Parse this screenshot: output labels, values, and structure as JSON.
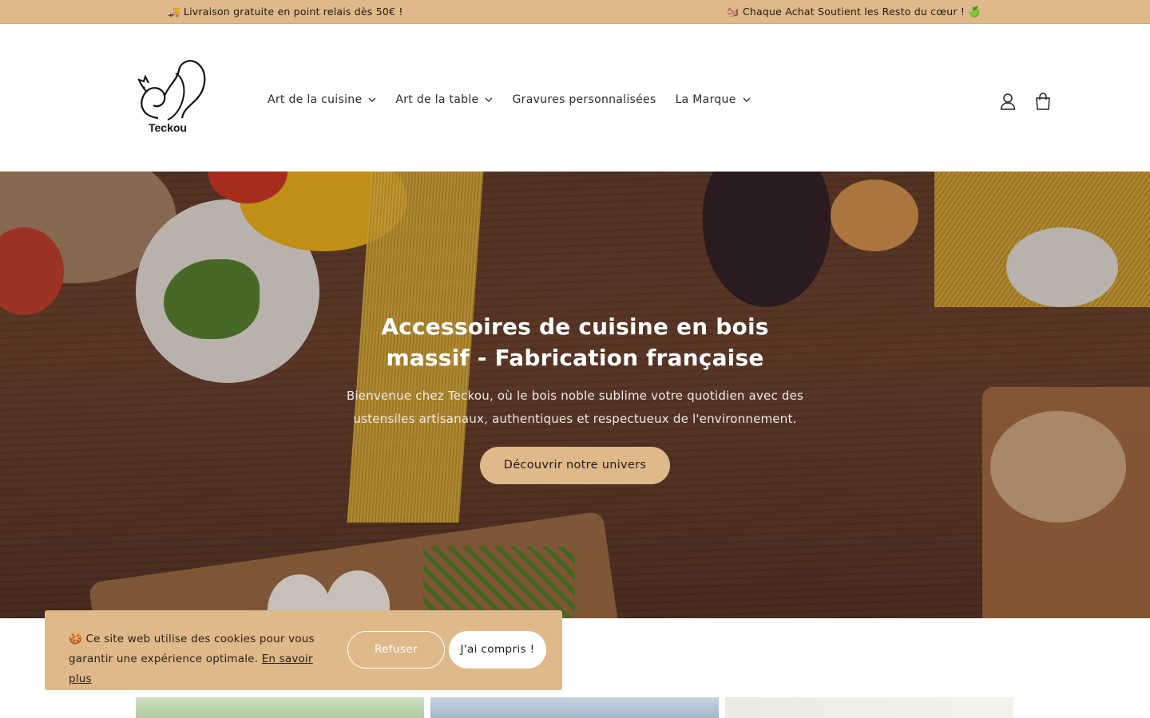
{
  "announcement": {
    "left": "🚚 Livraison gratuite en point relais dès 50€ !",
    "right": "🐿️ Chaque Achat Soutient les Resto du cœur ! 🍏"
  },
  "header": {
    "logo_text": "Teckou",
    "nav": [
      {
        "label": "Art de la cuisine",
        "has_dropdown": true
      },
      {
        "label": "Art de la table",
        "has_dropdown": true
      },
      {
        "label": "Gravures personnalisées",
        "has_dropdown": false
      },
      {
        "label": "La Marque",
        "has_dropdown": true
      }
    ],
    "icons": [
      "account-icon",
      "cart-icon"
    ]
  },
  "hero": {
    "title": "Accessoires de cuisine en bois massif - Fabrication française",
    "subtitle": "Bienvenue chez Teckou, où le bois noble sublime votre quotidien avec des ustensiles artisanaux, authentiques et respectueux de l'environnement.",
    "cta": "Découvrir notre univers"
  },
  "cookie": {
    "text": "🍪 Ce site web utilise des cookies pour vous garantir une expérience optimale.",
    "link": "En savoir plus",
    "refuse": "Refuser",
    "accept": "J'ai compris !"
  },
  "colors": {
    "accent": "#dfb98a",
    "text": "#1a1a1a",
    "hero_wood": "#6e4330"
  }
}
